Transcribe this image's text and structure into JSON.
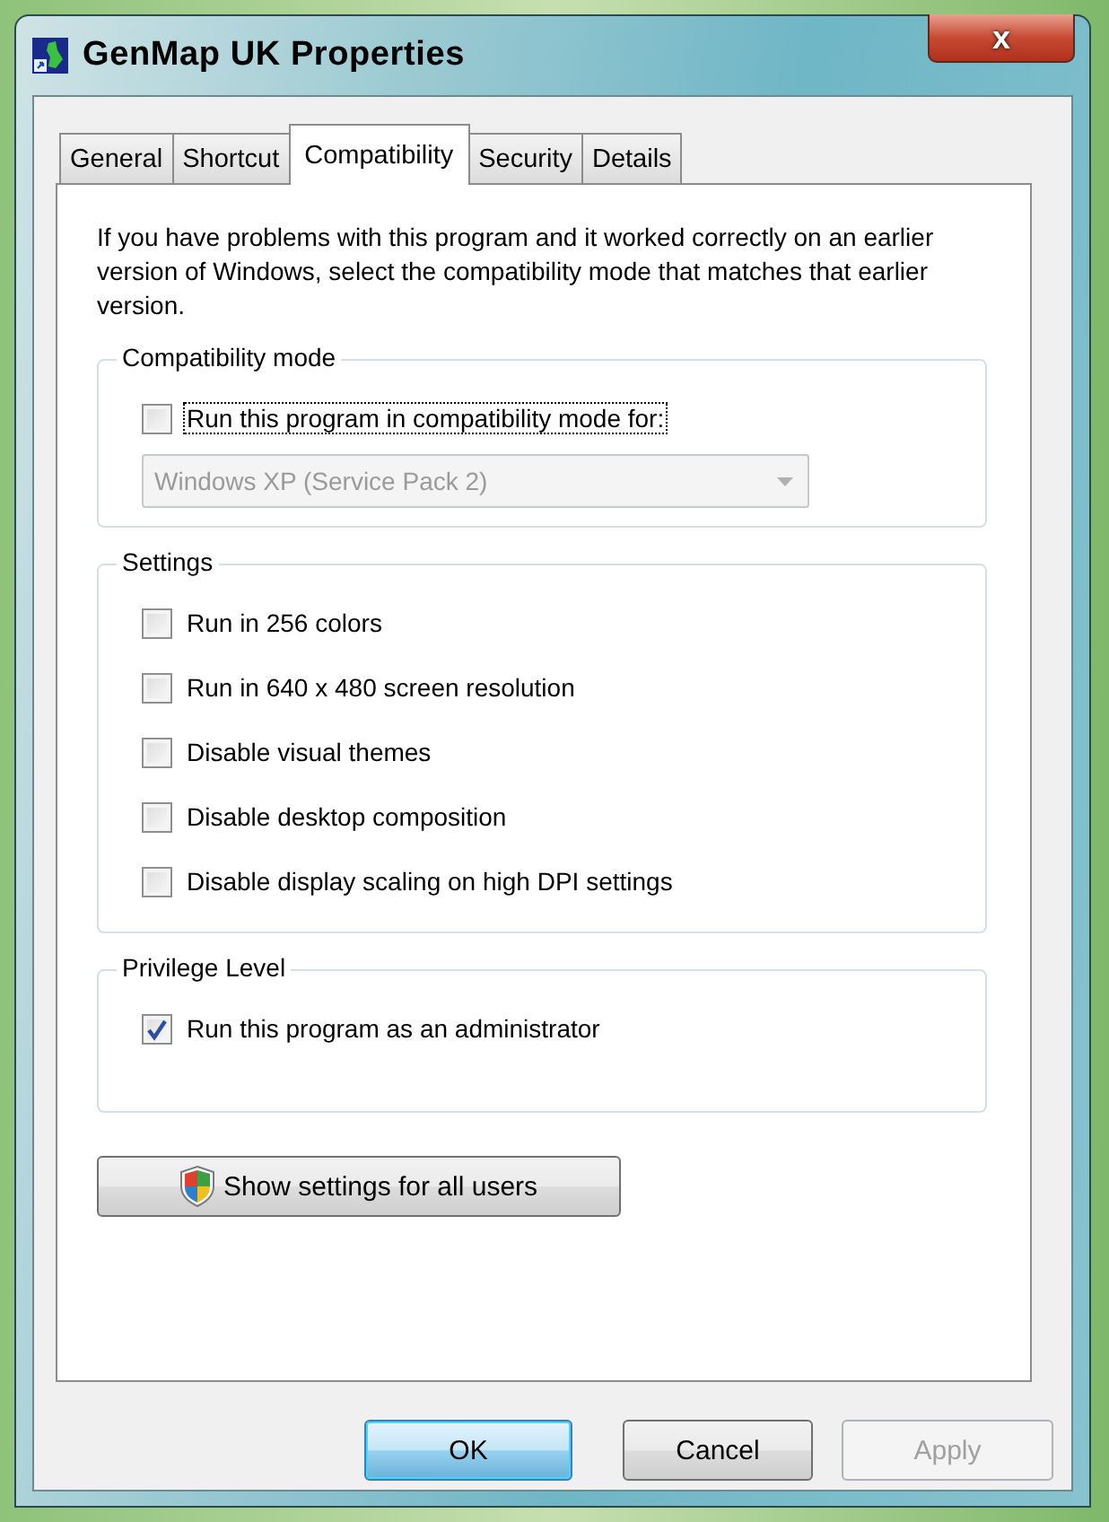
{
  "window": {
    "title": "GenMap UK Properties",
    "close": "x"
  },
  "tabs": [
    {
      "label": "General",
      "selected": false
    },
    {
      "label": "Shortcut",
      "selected": false
    },
    {
      "label": "Compatibility",
      "selected": true
    },
    {
      "label": "Security",
      "selected": false
    },
    {
      "label": "Details",
      "selected": false
    }
  ],
  "intro": "If you have problems with this program and it worked correctly on an earlier version of Windows, select the compatibility mode that matches that earlier version.",
  "groups": [
    {
      "title": "Compatibility mode",
      "items": [
        {
          "kind": "checkbox",
          "label": "Run this program in compatibility mode for:",
          "checked": false,
          "focused": true
        },
        {
          "kind": "dropdown",
          "value": "Windows XP (Service Pack 2)",
          "disabled": true
        }
      ]
    },
    {
      "title": "Settings",
      "items": [
        {
          "kind": "checkbox",
          "label": "Run in 256 colors",
          "checked": false,
          "focused": false
        },
        {
          "kind": "checkbox",
          "label": "Run in 640 x 480 screen resolution",
          "checked": false,
          "focused": false
        },
        {
          "kind": "checkbox",
          "label": "Disable visual themes",
          "checked": false,
          "focused": false
        },
        {
          "kind": "checkbox",
          "label": "Disable desktop composition",
          "checked": false,
          "focused": false
        },
        {
          "kind": "checkbox",
          "label": "Disable display scaling on high DPI settings",
          "checked": false,
          "focused": false
        }
      ]
    },
    {
      "title": "Privilege Level",
      "items": [
        {
          "kind": "checkbox",
          "label": "Run this program as an administrator",
          "checked": true,
          "focused": false
        }
      ]
    }
  ],
  "all_users_button": "Show settings for all users",
  "buttons": [
    {
      "label": "OK",
      "default": true,
      "disabled": false
    },
    {
      "label": "Cancel",
      "default": false,
      "disabled": false
    },
    {
      "label": "Apply",
      "default": false,
      "disabled": true
    }
  ]
}
